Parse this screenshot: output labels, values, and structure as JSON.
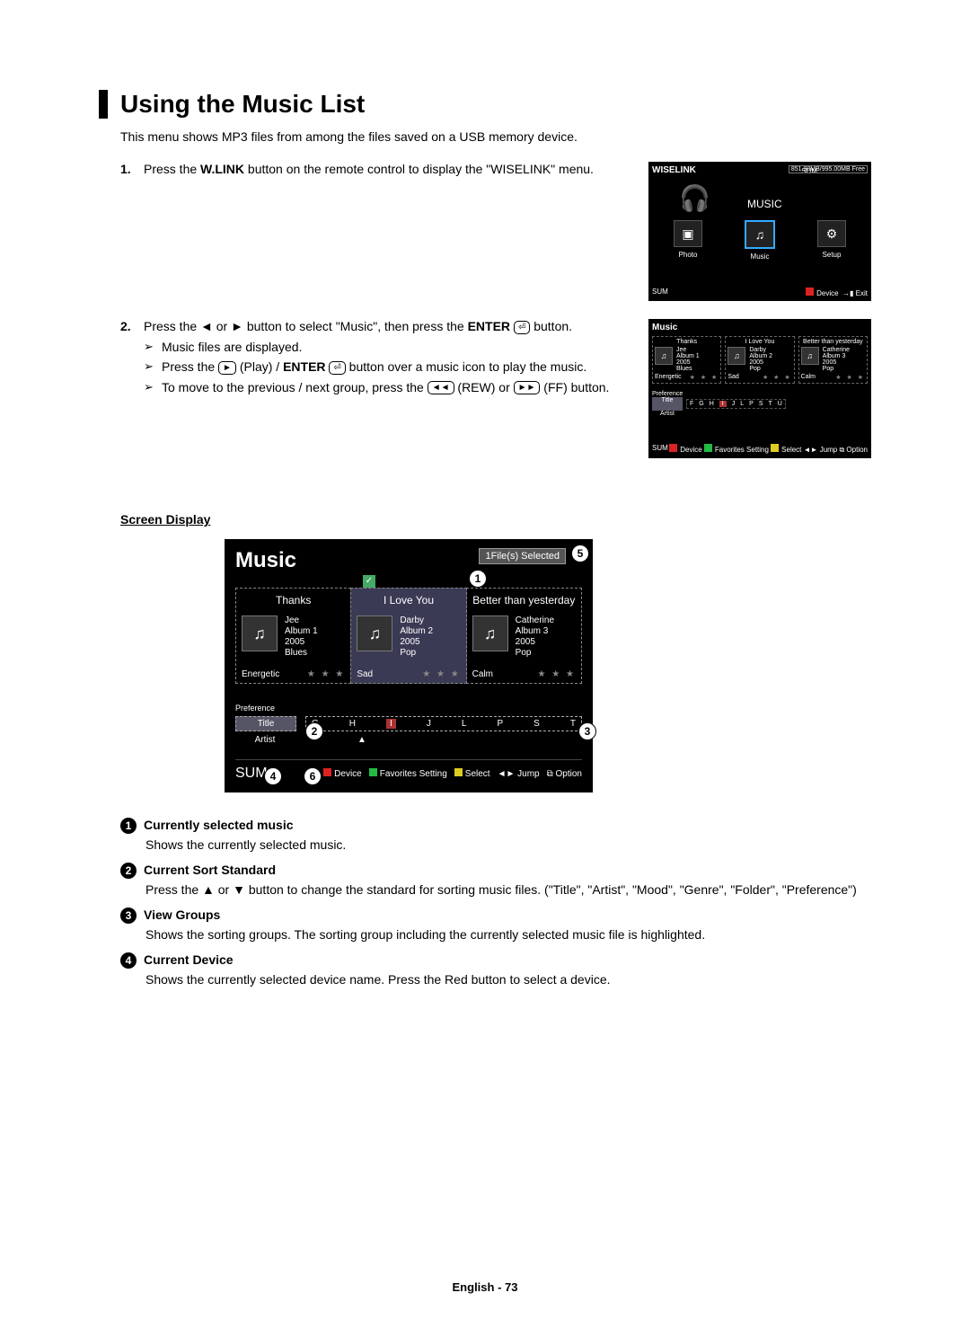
{
  "heading": "Using the Music List",
  "intro": "This menu shows MP3 files from among the files saved on a USB memory device.",
  "steps": {
    "s1_num": "1.",
    "s1_pre": "Press the ",
    "s1_bold": "W.LINK",
    "s1_post": " button on the remote control to display the \"WISELINK\" menu.",
    "s2_num": "2.",
    "s2_main_pre": "Press the ◄ or ► button to select \"Music\", then press the ",
    "s2_main_bold": "ENTER",
    "s2_main_icon": "⏎",
    "s2_main_post": " button.",
    "s2_b1": "Music files are displayed.",
    "s2_b2_pre": "Press the ",
    "s2_b2_icon1": "►",
    "s2_b2_mid1": " (Play) / ",
    "s2_b2_bold": "ENTER",
    "s2_b2_icon2": "⏎",
    "s2_b2_post": " button over a music icon to play the music.",
    "s2_b3_pre": "To move to the previous / next group, press the ",
    "s2_b3_icon1": "◄◄",
    "s2_b3_mid": " (REW) or ",
    "s2_b3_icon2": "►►",
    "s2_b3_post": " (FF) button."
  },
  "wiselink": {
    "title": "WISELINK",
    "sum": "SUM",
    "storage": "851.98MB/995.00MB Free",
    "music_label": "MUSIC",
    "photo": "Photo",
    "music": "Music",
    "setup": "Setup",
    "foot_sum": "SUM",
    "device": "Device",
    "exit": "Exit"
  },
  "mlistsmall": {
    "title": "Music",
    "cols": [
      "Thanks",
      "I Love You",
      "Better than yesterday"
    ],
    "cards": [
      {
        "artist": "Jee",
        "album": "Album 1",
        "year": "2005",
        "genre": "Blues",
        "mood": "Energetic"
      },
      {
        "artist": "Darby",
        "album": "Album 2",
        "year": "2005",
        "genre": "Pop",
        "mood": "Sad"
      },
      {
        "artist": "Catherine",
        "album": "Album 3",
        "year": "2005",
        "genre": "Pop",
        "mood": "Calm"
      }
    ],
    "pref": "Preference",
    "title_sort": "Title",
    "artist_sort": "Artist",
    "letters": [
      "F",
      "G",
      "H",
      "I",
      "J",
      "L",
      "P",
      "S",
      "T",
      "U"
    ],
    "bottom": {
      "sum": "SUM",
      "device": "Device",
      "fav": "Favorites Setting",
      "select": "Select",
      "jump": "Jump",
      "option": "Option"
    }
  },
  "screen_display_heading": "Screen Display",
  "large": {
    "title": "Music",
    "selected": "1File(s) Selected",
    "cols": [
      "Thanks",
      "I Love You",
      "Better than yesterday"
    ],
    "cards": [
      {
        "artist": "Jee",
        "album": "Album 1",
        "year": "2005",
        "genre": "Blues",
        "mood": "Energetic"
      },
      {
        "artist": "Darby",
        "album": "Album 2",
        "year": "2005",
        "genre": "Pop",
        "mood": "Sad"
      },
      {
        "artist": "Catherine",
        "album": "Album 3",
        "year": "2005",
        "genre": "Pop",
        "mood": "Calm"
      }
    ],
    "pref": "Preference",
    "title_sort": "Title",
    "artist_sort": "Artist",
    "letters": [
      "G",
      "H",
      "I",
      "J",
      "L",
      "P",
      "S",
      "T"
    ],
    "bottom": {
      "sum": "SUM",
      "device": "Device",
      "fav": "Favorites Setting",
      "select": "Select",
      "jump": "Jump",
      "option": "Option"
    }
  },
  "defs": [
    {
      "n": "1",
      "term": "Currently selected music",
      "body": "Shows the currently selected music."
    },
    {
      "n": "2",
      "term": "Current Sort Standard",
      "body": "Press the ▲ or ▼ button to change the standard for sorting music files. (\"Title\", \"Artist\", \"Mood\", \"Genre\", \"Folder\", \"Preference\")"
    },
    {
      "n": "3",
      "term": "View Groups",
      "body": "Shows the sorting groups. The sorting group including the currently selected music file is highlighted."
    },
    {
      "n": "4",
      "term": "Current Device",
      "body": "Shows the currently selected device name. Press the Red button to select a device."
    }
  ],
  "footer": {
    "lang": "English - ",
    "page": "73"
  },
  "glyph": {
    "note": "♫",
    "headphone": "🎧",
    "gear": "⚙",
    "photo": "▣",
    "star": "★ ★ ★",
    "check": "✓",
    "arrow": "➢",
    "return": "↵",
    "rew": "◄◄",
    "ff": "►►",
    "up": "▲"
  }
}
